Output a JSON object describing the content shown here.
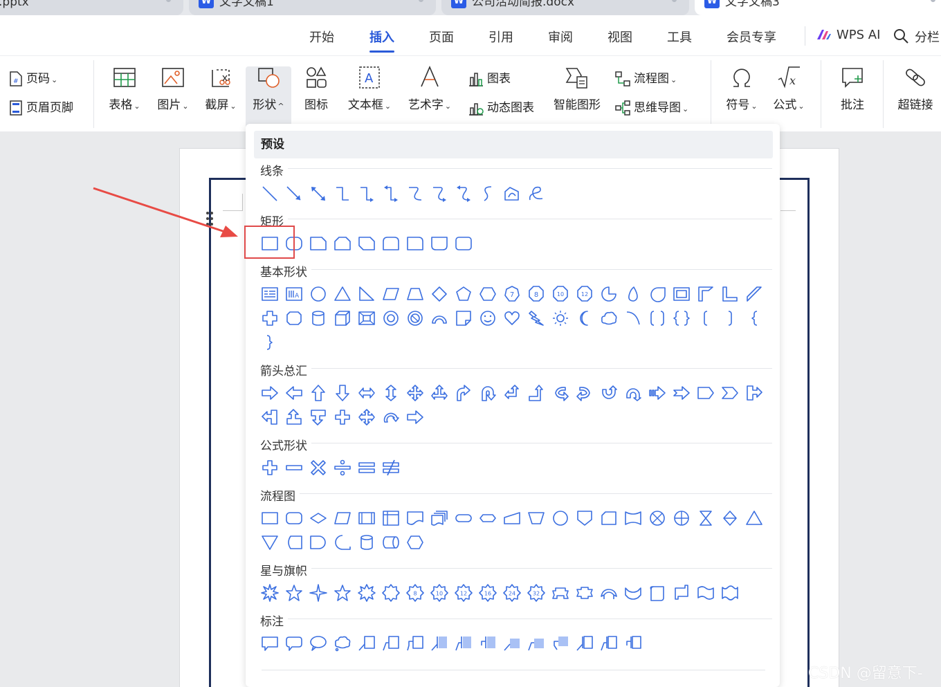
{
  "tabs": [
    {
      "label": ".pptx",
      "icon": "wps-presentation-icon",
      "active": false
    },
    {
      "label": "文字文稿1",
      "icon": "wps-writer-icon",
      "active": false
    },
    {
      "label": "公司活动简报.docx",
      "icon": "wps-writer-icon",
      "active": false
    },
    {
      "label": "文字文稿3",
      "icon": "wps-writer-icon",
      "active": true
    }
  ],
  "tab_icon_letter": "W",
  "menu": {
    "items": [
      "开始",
      "插入",
      "页面",
      "引用",
      "审阅",
      "视图",
      "工具",
      "会员专享"
    ],
    "active": "插入",
    "wps_ai": "WPS AI",
    "search_label": "分栏"
  },
  "toolbar": {
    "page_number": "页码",
    "header_footer": "页眉页脚",
    "table": "表格",
    "picture": "图片",
    "screenshot": "截屏",
    "shape": "形状",
    "icon": "图标",
    "textbox": "文本框",
    "wordart": "艺术字",
    "chart": "图表",
    "dynamic_chart": "动态图表",
    "smart_graphic": "智能图形",
    "flowchart": "流程图",
    "mindmap": "思维导图",
    "symbol": "符号",
    "formula": "公式",
    "comment": "批注",
    "hyperlink": "超链接"
  },
  "dropdown": {
    "header": "预设",
    "sections": [
      {
        "title": "线条",
        "count": 12
      },
      {
        "title": "矩形",
        "count": 9
      },
      {
        "title": "基本形状",
        "count": 43
      },
      {
        "title": "箭头总汇",
        "count": 28
      },
      {
        "title": "公式形状",
        "count": 6
      },
      {
        "title": "流程图",
        "count": 28
      },
      {
        "title": "星与旗帜",
        "count": 20
      },
      {
        "title": "标注",
        "count": 16
      }
    ]
  },
  "shape_labels": {
    "octagon_numbers": [
      "7",
      "8",
      "10",
      "12"
    ],
    "star_numbers": [
      "8",
      "10",
      "12",
      "16",
      "24",
      "32"
    ]
  },
  "watermark": "CSDN @留意下-",
  "colors": {
    "accent": "#2a5ad9",
    "shape_stroke": "#3b6fe0",
    "highlight": "#e04a4a",
    "page_border": "#1e2f5b"
  }
}
